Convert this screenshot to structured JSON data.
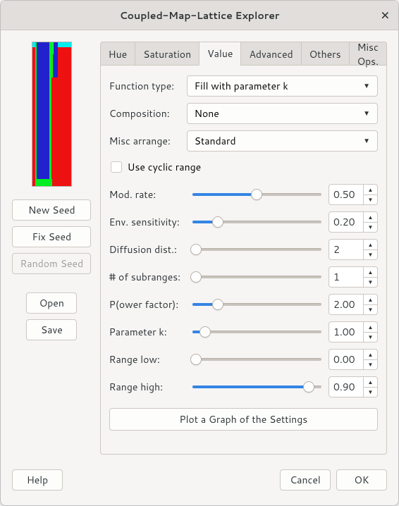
{
  "window": {
    "title": "Coupled-Map-Lattice Explorer"
  },
  "left": {
    "new_seed": "New Seed",
    "fix_seed": "Fix Seed",
    "random_seed": "Random Seed",
    "open": "Open",
    "save": "Save"
  },
  "tabs": {
    "hue": "Hue",
    "saturation": "Saturation",
    "value": "Value",
    "advanced": "Advanced",
    "others": "Others",
    "misc_ops": "Misc Ops."
  },
  "form": {
    "function_type_label": "Function type:",
    "function_type_value": "Fill with parameter k",
    "composition_label": "Composition:",
    "composition_value": "None",
    "misc_arrange_label": "Misc arrange:",
    "misc_arrange_value": "Standard",
    "use_cyclic_label": "Use cyclic range"
  },
  "sliders": {
    "mod_rate": {
      "label": "Mod. rate:",
      "value": "0.50",
      "pct": 50
    },
    "env_sens": {
      "label": "Env. sensitivity:",
      "value": "0.20",
      "pct": 20
    },
    "diff_dist": {
      "label": "Diffusion dist.:",
      "value": "2",
      "pct": 3
    },
    "subranges": {
      "label": "# of subranges:",
      "value": "1",
      "pct": 3
    },
    "power": {
      "label": "P(ower factor):",
      "value": "2.00",
      "pct": 20
    },
    "param_k": {
      "label": "Parameter k:",
      "value": "1.00",
      "pct": 10
    },
    "range_low": {
      "label": "Range low:",
      "value": "0.00",
      "pct": 3
    },
    "range_high": {
      "label": "Range high:",
      "value": "0.90",
      "pct": 90
    }
  },
  "plot_btn": "Plot a Graph of the Settings",
  "footer": {
    "help": "Help",
    "cancel": "Cancel",
    "ok": "OK"
  }
}
